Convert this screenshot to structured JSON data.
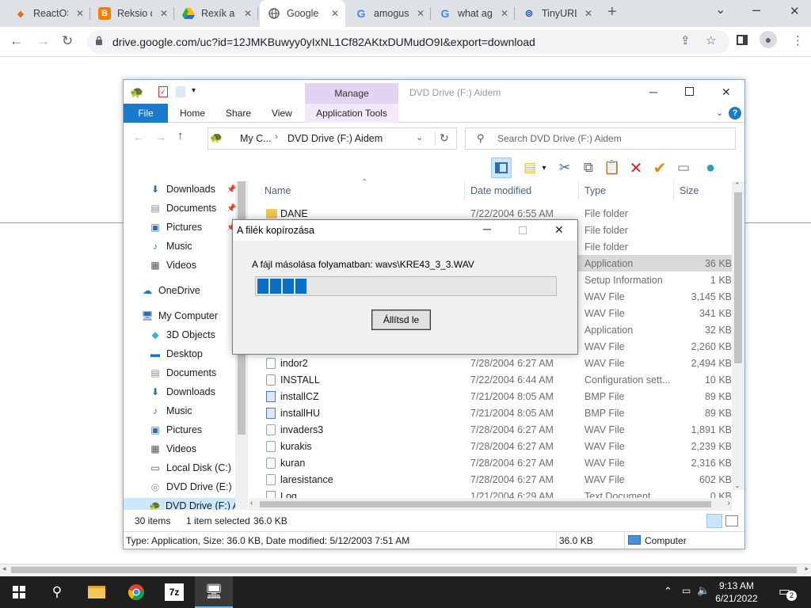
{
  "browser": {
    "tabs": [
      {
        "title": "ReactOS",
        "icon": "reactos-icon",
        "color": "#e8710a"
      },
      {
        "title": "Reksio d",
        "icon": "blogger-icon",
        "color": "#f57d00"
      },
      {
        "title": "Rexík a",
        "icon": "drive-icon",
        "color": "#1a73e8"
      },
      {
        "title": "Google",
        "icon": "globe-icon",
        "color": "#5f6368"
      },
      {
        "title": "amogus",
        "icon": "google-icon",
        "color": "#4285f4"
      },
      {
        "title": "what ag",
        "icon": "google-icon",
        "color": "#4285f4"
      },
      {
        "title": "TinyURL",
        "icon": "tinyurl-icon",
        "color": "#1b4fb4"
      }
    ],
    "url": "drive.google.com/uc?id=12JMKBuwyy0yIxNL1Cf82AKtxDUMudO9I&export=download"
  },
  "explorer": {
    "title": "DVD Drive (F:) Aidem",
    "manage_label": "Manage",
    "ribbon_tabs": {
      "file": "File",
      "home": "Home",
      "share": "Share",
      "view": "View",
      "app_tools": "Application Tools"
    },
    "breadcrumb": {
      "root": "My C...",
      "current": "DVD Drive (F:) Aidem"
    },
    "search_placeholder": "Search DVD Drive (F:) Aidem",
    "columns": {
      "name": "Name",
      "date": "Date modified",
      "type": "Type",
      "size": "Size"
    },
    "nav_items": [
      {
        "label": "Downloads",
        "icon": "download-arrow-icon"
      },
      {
        "label": "Documents",
        "icon": "document-icon"
      },
      {
        "label": "Pictures",
        "icon": "pictures-icon"
      },
      {
        "label": "Music",
        "icon": "music-icon"
      },
      {
        "label": "Videos",
        "icon": "video-icon"
      },
      {
        "label": "OneDrive",
        "icon": "cloud-icon"
      },
      {
        "label": "My Computer",
        "icon": "computer-icon"
      },
      {
        "label": "3D Objects",
        "icon": "cube-icon"
      },
      {
        "label": "Desktop",
        "icon": "desktop-icon"
      },
      {
        "label": "Documents",
        "icon": "document-icon"
      },
      {
        "label": "Downloads",
        "icon": "download-arrow-icon"
      },
      {
        "label": "Music",
        "icon": "music-icon"
      },
      {
        "label": "Pictures",
        "icon": "pictures-icon"
      },
      {
        "label": "Videos",
        "icon": "video-icon"
      },
      {
        "label": "Local Disk (C:)",
        "icon": "disk-icon"
      },
      {
        "label": "DVD Drive (E:) RE",
        "icon": "dvd-icon"
      },
      {
        "label": "DVD Drive (F:) Ai",
        "icon": "dvd-icon"
      }
    ],
    "files": [
      {
        "name": "DANE",
        "date": "7/22/2004 6:55 AM",
        "type": "File folder",
        "size": ""
      },
      {
        "name": "",
        "date": "",
        "type": "File folder",
        "size": ""
      },
      {
        "name": "",
        "date": "",
        "type": "File folder",
        "size": ""
      },
      {
        "name": "",
        "date": "",
        "type": "Application",
        "size": "36 KB"
      },
      {
        "name": "",
        "date": "",
        "type": "Setup Information",
        "size": "1 KB"
      },
      {
        "name": "",
        "date": "",
        "type": "WAV File",
        "size": "3,145 KB"
      },
      {
        "name": "",
        "date": "",
        "type": "WAV File",
        "size": "341 KB"
      },
      {
        "name": "",
        "date": "",
        "type": "Application",
        "size": "32 KB"
      },
      {
        "name": "",
        "date": "",
        "type": "WAV File",
        "size": "2,260 KB"
      },
      {
        "name": "indor2",
        "date": "7/28/2004 6:27 AM",
        "type": "WAV File",
        "size": "2,494 KB"
      },
      {
        "name": "INSTALL",
        "date": "7/22/2004 6:44 AM",
        "type": "Configuration sett...",
        "size": "10 KB"
      },
      {
        "name": "installCZ",
        "date": "7/21/2004 8:05 AM",
        "type": "BMP File",
        "size": "89 KB"
      },
      {
        "name": "installHU",
        "date": "7/21/2004 8:05 AM",
        "type": "BMP File",
        "size": "89 KB"
      },
      {
        "name": "invaders3",
        "date": "7/28/2004 6:27 AM",
        "type": "WAV File",
        "size": "1,891 KB"
      },
      {
        "name": "kurakis",
        "date": "7/28/2004 6:27 AM",
        "type": "WAV File",
        "size": "2,239 KB"
      },
      {
        "name": "kuran",
        "date": "7/28/2004 6:27 AM",
        "type": "WAV File",
        "size": "2,316 KB"
      },
      {
        "name": "laresistance",
        "date": "7/28/2004 6:27 AM",
        "type": "WAV File",
        "size": "602 KB"
      },
      {
        "name": "Log",
        "date": "1/21/2004 6:29 AM",
        "type": "Text Document",
        "size": "0 KB"
      }
    ],
    "status": {
      "items": "30 items",
      "selected": "1 item selected",
      "sel_size": "36.0 KB",
      "details": "Type: Application, Size: 36.0 KB, Date modified: 5/12/2003 7:51 AM",
      "size2": "36.0 KB",
      "location": "Computer"
    }
  },
  "dialog": {
    "title": "A filék kopírozása",
    "message": "A fájl másolása folyamatban: wavs\\KRE43_3_3.WAV",
    "progress_blocks": 4,
    "progress_fraction": 0.17,
    "button": "Állítsd le"
  },
  "taskbar": {
    "time": "9:13 AM",
    "date": "6/21/2022",
    "notifications": "2"
  }
}
